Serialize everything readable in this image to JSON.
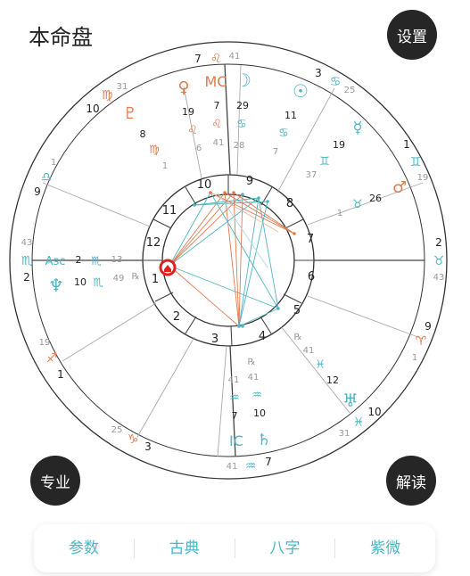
{
  "page": {
    "title": "本命盘"
  },
  "buttons": {
    "settings": "设置",
    "professional": "专业",
    "interpret": "解读"
  },
  "tabs": [
    "参数",
    "古典",
    "八字",
    "紫微"
  ],
  "colors": {
    "fire": "#e07b4f",
    "water": "#4fb5c4",
    "earth": "#4fb5c4",
    "ink": "#222222",
    "dim": "#999999"
  },
  "chart": {
    "house_numbers": [
      "1",
      "2",
      "3",
      "4",
      "5",
      "6",
      "7",
      "8",
      "9",
      "10",
      "11",
      "12"
    ],
    "cusps": [
      {
        "name": "cusp-7",
        "deg": "7",
        "sign": "♌",
        "min": "41",
        "color": "fire"
      },
      {
        "name": "cusp-3",
        "deg": "3",
        "sign": "♋",
        "min": "25",
        "color": "water"
      },
      {
        "name": "cusp-1",
        "deg": "1",
        "sign": "♊",
        "min": "19",
        "color": "water"
      },
      {
        "name": "cusp-2",
        "deg": "2",
        "sign": "♉",
        "min": "43",
        "color": "earth"
      },
      {
        "name": "cusp-9",
        "deg": "9",
        "sign": "♈",
        "min": "1",
        "color": "fire"
      },
      {
        "name": "cusp-10",
        "deg": "10",
        "sign": "♓",
        "min": "31",
        "color": "water"
      },
      {
        "name": "cusp-7b",
        "deg": "7",
        "sign": "♒",
        "min": "41",
        "color": "water"
      },
      {
        "name": "cusp-3b",
        "deg": "3",
        "sign": "♑",
        "min": "25",
        "color": "earth"
      },
      {
        "name": "cusp-1b",
        "deg": "1",
        "sign": "♐",
        "min": "19",
        "color": "fire"
      },
      {
        "name": "cusp-2b",
        "deg": "2",
        "sign": "♏",
        "min": "43",
        "color": "water"
      },
      {
        "name": "cusp-9b",
        "deg": "9",
        "sign": "♎",
        "min": "1",
        "color": "water"
      },
      {
        "name": "cusp-10b",
        "deg": "10",
        "sign": "♍",
        "min": "31",
        "color": "earth"
      }
    ],
    "asc": {
      "label": "Asc",
      "deg": "2",
      "sign": "♏",
      "min": "13"
    },
    "mc": {
      "label": "MC"
    },
    "ic": {
      "label": "IC"
    },
    "planets": [
      {
        "name": "venus",
        "glyph": "♀",
        "deg": "19",
        "sign": "♌",
        "min": "6",
        "color": "fire"
      },
      {
        "name": "mc",
        "glyph": "MC",
        "deg": "7",
        "sign": "♌",
        "min": "41",
        "color": "fire"
      },
      {
        "name": "moon",
        "glyph": "☽",
        "deg": "29",
        "sign": "♋",
        "min": "28",
        "color": "water"
      },
      {
        "name": "sun",
        "glyph": "☉",
        "deg": "11",
        "sign": "♋",
        "min": "7",
        "color": "water"
      },
      {
        "name": "pluto",
        "glyph": "♇",
        "deg": "8",
        "sign": "♍",
        "min": "1",
        "color": "earth"
      },
      {
        "name": "mercury",
        "glyph": "☿",
        "deg": "19",
        "sign": "♊",
        "min": "37",
        "color": "water"
      },
      {
        "name": "mars",
        "glyph": "♂",
        "deg": "26",
        "sign": "♉",
        "min": "1",
        "color": "fire"
      },
      {
        "name": "neptune",
        "glyph": "♆",
        "deg": "10",
        "sign": "♏",
        "min": "49",
        "color": "water",
        "retro": "℞"
      },
      {
        "name": "uranus",
        "glyph": "♅",
        "deg": "12",
        "sign": "♓",
        "min": "41",
        "color": "water",
        "retro": "℞"
      },
      {
        "name": "saturn",
        "glyph": "♄",
        "deg": "10",
        "sign": "♒",
        "min": "41",
        "color": "water",
        "retro": "℞"
      }
    ]
  }
}
